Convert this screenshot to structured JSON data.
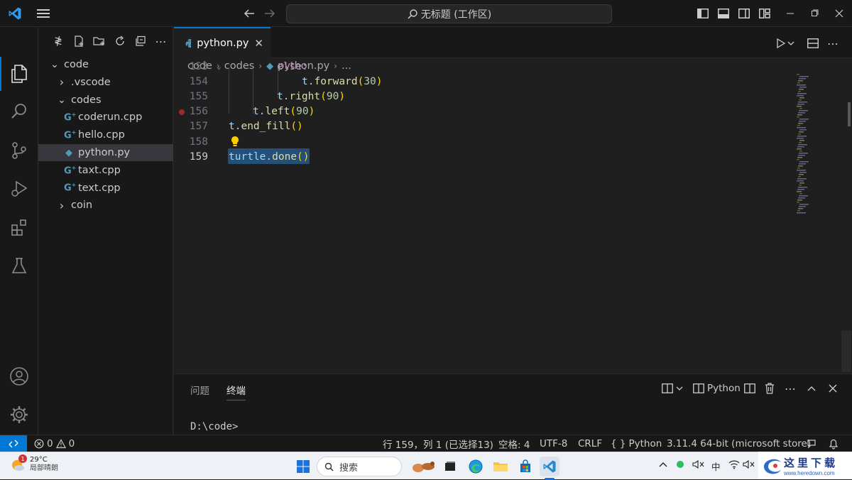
{
  "titlebar": {
    "command_center": "无标题 (工作区)"
  },
  "activity_bar": {
    "items": [
      "explorer",
      "search",
      "source-control",
      "run-debug",
      "extensions",
      "testing"
    ],
    "bottom": [
      "accounts",
      "manage"
    ]
  },
  "explorer": {
    "tree": [
      {
        "label": "code",
        "kind": "folder-open",
        "depth": 0
      },
      {
        "label": ".vscode",
        "kind": "folder",
        "depth": 1
      },
      {
        "label": "codes",
        "kind": "folder-open",
        "depth": 1
      },
      {
        "label": "coderun.cpp",
        "kind": "cpp",
        "depth": 2
      },
      {
        "label": "hello.cpp",
        "kind": "cpp",
        "depth": 2
      },
      {
        "label": "python.py",
        "kind": "py",
        "depth": 2,
        "selected": true
      },
      {
        "label": "taxt.cpp",
        "kind": "cpp",
        "depth": 2
      },
      {
        "label": "text.cpp",
        "kind": "cpp",
        "depth": 2
      },
      {
        "label": "coin",
        "kind": "folder",
        "depth": 1
      }
    ]
  },
  "editor": {
    "tab_label": "python.py",
    "breadcrumb": [
      "code",
      "codes",
      "python.py",
      "..."
    ],
    "lines": [
      {
        "num": "153",
        "parts": [
          {
            "t": "else:",
            "c": "kw"
          }
        ]
      },
      {
        "num": "154",
        "parts": [
          {
            "t": "t",
            "c": "var"
          },
          {
            "t": ".",
            "c": "plain"
          },
          {
            "t": "forward",
            "c": "fn"
          },
          {
            "t": "(",
            "c": "pn"
          },
          {
            "t": "30",
            "c": "num"
          },
          {
            "t": ")",
            "c": "pn"
          }
        ]
      },
      {
        "num": "155",
        "parts": [
          {
            "t": "t",
            "c": "var"
          },
          {
            "t": ".",
            "c": "plain"
          },
          {
            "t": "right",
            "c": "fn"
          },
          {
            "t": "(",
            "c": "pn"
          },
          {
            "t": "90",
            "c": "num"
          },
          {
            "t": ")",
            "c": "pn"
          }
        ]
      },
      {
        "num": "156",
        "parts": [
          {
            "t": "t",
            "c": "var"
          },
          {
            "t": ".",
            "c": "plain"
          },
          {
            "t": "left",
            "c": "fn"
          },
          {
            "t": "(",
            "c": "pn"
          },
          {
            "t": "90",
            "c": "num"
          },
          {
            "t": ")",
            "c": "pn"
          }
        ],
        "breakpoint": true
      },
      {
        "num": "157",
        "parts": [
          {
            "t": "t",
            "c": "var"
          },
          {
            "t": ".",
            "c": "plain"
          },
          {
            "t": "end_fill",
            "c": "fn"
          },
          {
            "t": "()",
            "c": "pn"
          }
        ]
      },
      {
        "num": "158",
        "parts": [],
        "lightbulb": true
      },
      {
        "num": "159",
        "parts": [
          {
            "t": "turtle",
            "c": "var"
          },
          {
            "t": ".",
            "c": "plain"
          },
          {
            "t": "done",
            "c": "fn"
          },
          {
            "t": "()",
            "c": "pn"
          }
        ],
        "current": true,
        "selected": true
      }
    ]
  },
  "panel": {
    "tabs": [
      "问题",
      "终端"
    ],
    "active_tab": "终端",
    "terminal_label": "Python",
    "terminal_text": "D:\\code>"
  },
  "status_bar": {
    "errors": "0",
    "warnings": "0",
    "cursor": "行 159，列 1 (已选择13)",
    "indent": "空格: 4",
    "encoding": "UTF-8",
    "eol": "CRLF",
    "language": "Python",
    "interpreter": "3.11.4 64-bit (microsoft store)"
  },
  "taskbar": {
    "weather_temp": "29°C",
    "weather_desc": "局部晴朗",
    "weather_badge": "1",
    "search_label": "搜索",
    "tray_input": "中"
  },
  "watermark": {
    "text": "这里下载",
    "url": "www.heredown.com"
  },
  "colors": {
    "accent": "#0078d4",
    "selection": "#264f78",
    "breakpoint": "#9e2a2a"
  }
}
